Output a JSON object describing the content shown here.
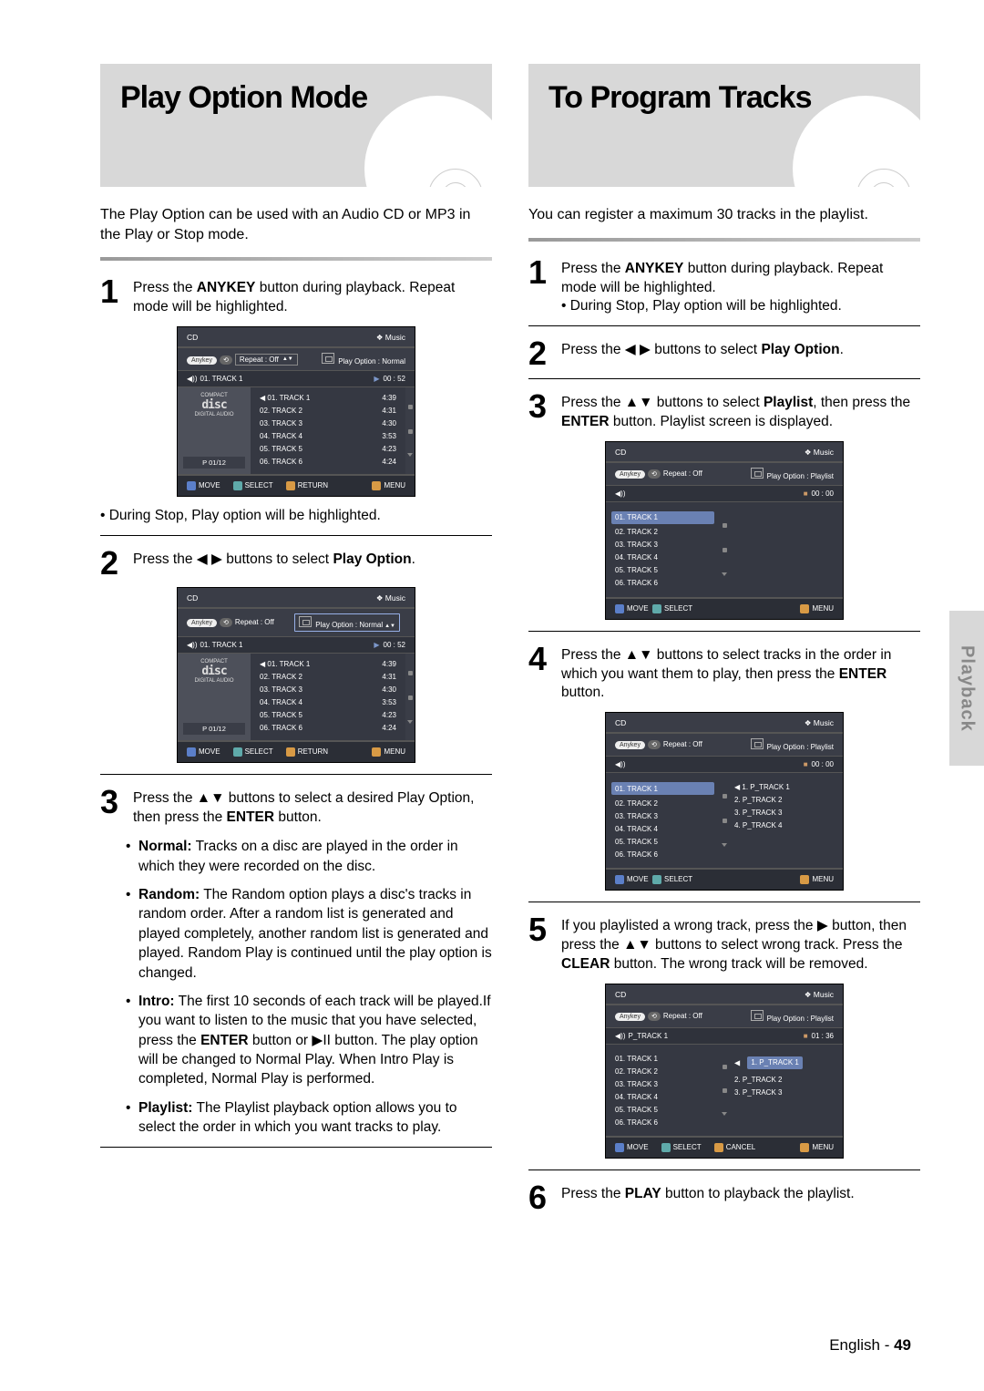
{
  "page": {
    "lang": "English",
    "num": "49",
    "side_tab": "Playback"
  },
  "left": {
    "title": "Play Option Mode",
    "intro": "The Play Option can be used with an Audio CD or MP3 in the Play or Stop mode.",
    "step1": {
      "t1": "Press the ",
      "t2": "ANYKEY",
      "t3": " button during playback. Repeat mode will be highlighted."
    },
    "note1": "• During Stop, Play option will be highlighted.",
    "step2": {
      "t1": "Press the ",
      "t2": " buttons to select ",
      "t3": "Play Option",
      "t4": "."
    },
    "step3": {
      "t1": "Press the ",
      "t2": " buttons to select a desired Play Option, then press the ",
      "t3": "ENTER",
      "t4": " button."
    },
    "bullets": {
      "b1a": "Normal:",
      "b1b": " Tracks on a disc are played in the order in which they were recorded on the disc.",
      "b2a": "Random:",
      "b2b": " The Random option plays a disc's tracks in random order. After a random list is generated and played completely, another random list is generated and played. Random Play is continued until the play option is changed.",
      "b3a": "Intro:",
      "b3b": " The first 10 seconds of each track will be played.If you want to listen to the music that you have selected, press the ",
      "b3c": "ENTER",
      "b3d": " button or ",
      "b3e": " button. The play option will be changed to Normal Play. When Intro Play is completed, Normal Play is performed.",
      "b4a": "Playlist:",
      "b4b": " The Playlist playback option allows you to select the order in which you want tracks to play."
    }
  },
  "right": {
    "title": "To Program Tracks",
    "intro": "You can register a maximum 30 tracks in the playlist.",
    "step1": {
      "t1": "Press the ",
      "t2": "ANYKEY",
      "t3": " button during playback. Repeat mode will be highlighted.",
      "sub": "• During Stop, Play option will be highlighted."
    },
    "step2": {
      "t1": "Press the ",
      "t2": " buttons to select ",
      "t3": "Play Option",
      "t4": "."
    },
    "step3": {
      "t1": "Press the ",
      "t2": " buttons to select ",
      "t3": "Playlist",
      "t4": ", then press the ",
      "t5": "ENTER",
      "t6": " button. Playlist screen is displayed."
    },
    "step4": {
      "t1": "Press the ",
      "t2": " buttons to select tracks in the order in which you want them to play, then press the ",
      "t3": "ENTER",
      "t4": " button."
    },
    "step5": {
      "t1": "If you playlisted a wrong track, press the ",
      "t2": " button, then press the ",
      "t3": " buttons to select wrong track. Press the ",
      "t4": "CLEAR",
      "t5": " button. The wrong track will be removed."
    },
    "step6": {
      "t1": "Press the ",
      "t2": "PLAY",
      "t3": " button to playback the playlist."
    }
  },
  "screen_common": {
    "cd": "CD",
    "music": "Music",
    "anykey": "Anykey",
    "repeat_off": "Repeat : Off",
    "move": "MOVE",
    "select": "SELECT",
    "return": "RETURN",
    "menu": "MENU",
    "cancel": "CANCEL",
    "compact": "COMPACT",
    "disc": "disc",
    "digital": "DIGITAL AUDIO"
  },
  "screens": {
    "A": {
      "po": "Play Option : Normal",
      "now_track": "01. TRACK 1",
      "time": "00 : 52",
      "counter": "01/12",
      "tracks": [
        {
          "n": "01. TRACK 1",
          "d": "4:39"
        },
        {
          "n": "02. TRACK 2",
          "d": "4:31"
        },
        {
          "n": "03. TRACK 3",
          "d": "4:30"
        },
        {
          "n": "04. TRACK 4",
          "d": "3:53"
        },
        {
          "n": "05. TRACK 5",
          "d": "4:23"
        },
        {
          "n": "06. TRACK 6",
          "d": "4:24"
        }
      ]
    },
    "C": {
      "po": "Play Option : Playlist",
      "time": "00 : 00",
      "tracks": [
        "01. TRACK 1",
        "02. TRACK 2",
        "03. TRACK 3",
        "04. TRACK 4",
        "05. TRACK 5",
        "06. TRACK 6"
      ]
    },
    "D": {
      "po": "Play Option : Playlist",
      "time": "00 : 00",
      "left": [
        "01. TRACK 1",
        "02. TRACK 2",
        "03. TRACK 3",
        "04. TRACK 4",
        "05. TRACK 5",
        "06. TRACK 6"
      ],
      "right": [
        "1. P_TRACK 1",
        "2. P_TRACK 2",
        "3. P_TRACK 3",
        "4. P_TRACK 4"
      ]
    },
    "E": {
      "po": "Play Option : Playlist",
      "now": "P_TRACK 1",
      "time": "01 : 36",
      "left": [
        "01. TRACK 1",
        "02. TRACK 2",
        "03. TRACK 3",
        "04. TRACK 4",
        "05. TRACK 5",
        "06. TRACK 6"
      ],
      "right": [
        "1. P_TRACK 1",
        "2. P_TRACK 2",
        "3. P_TRACK 3"
      ]
    }
  },
  "sym": {
    "lr": "◀ ▶",
    "ud": "▲▼",
    "r": "▶",
    "playpause": "▶II",
    "play": "▶",
    "stop": "■",
    "spk": "◀))",
    "p_icon": "P"
  }
}
